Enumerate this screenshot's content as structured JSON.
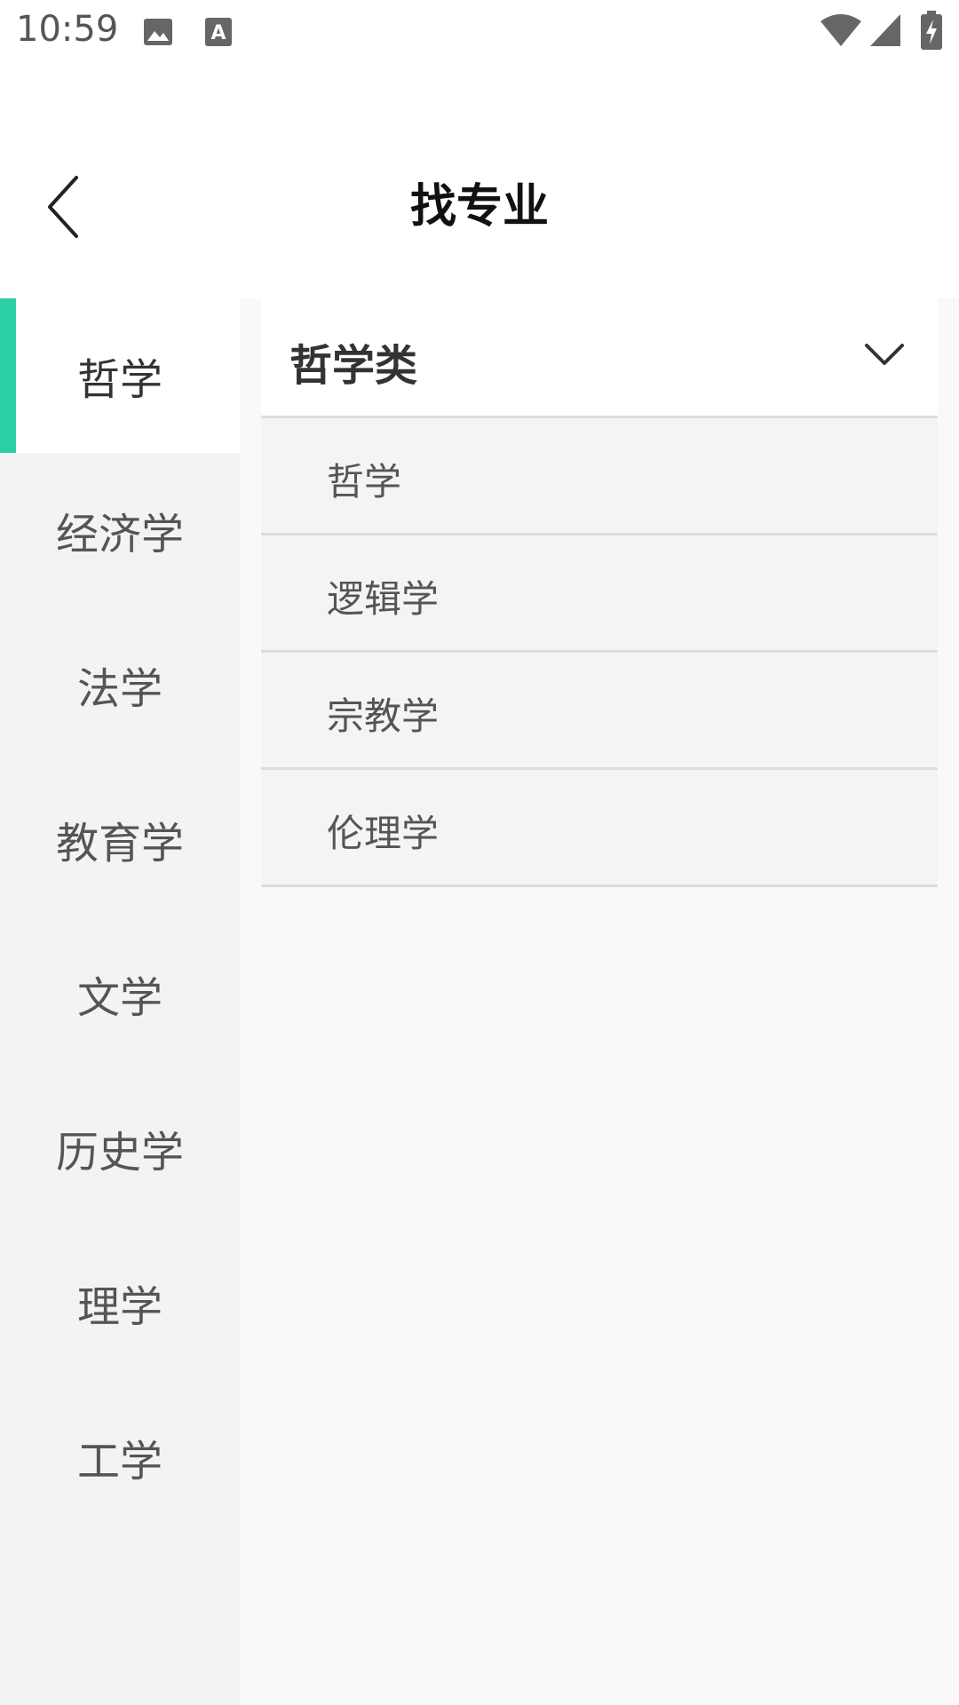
{
  "status_bar": {
    "time": "10:59",
    "icons_left": [
      "image-icon",
      "text-a-icon"
    ],
    "icons_right": [
      "wifi-icon",
      "signal-icon",
      "battery-charging-icon"
    ]
  },
  "header": {
    "title": "找专业",
    "back_icon": "chevron-left-icon"
  },
  "sidebar": {
    "accent_color": "#2ccfa3",
    "active_index": 0,
    "items": [
      {
        "label": "哲学"
      },
      {
        "label": "经济学"
      },
      {
        "label": "法学"
      },
      {
        "label": "教育学"
      },
      {
        "label": "文学"
      },
      {
        "label": "历史学"
      },
      {
        "label": "理学"
      },
      {
        "label": "工学"
      }
    ]
  },
  "content": {
    "group": {
      "title": "哲学类",
      "expanded": true,
      "toggle_icon": "chevron-down-icon",
      "items": [
        {
          "label": "哲学"
        },
        {
          "label": "逻辑学"
        },
        {
          "label": "宗教学"
        },
        {
          "label": "伦理学"
        }
      ]
    }
  }
}
